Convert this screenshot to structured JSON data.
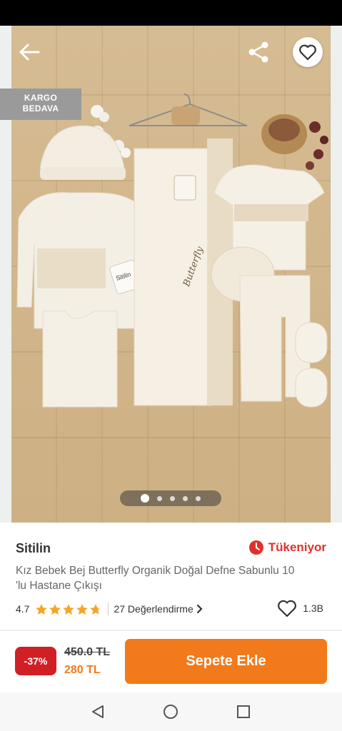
{
  "gallery": {
    "cargo_badge_line1": "KARGO",
    "cargo_badge_line2": "BEDAVA",
    "product_print": "Butterfly",
    "tag_text": "Sitilin",
    "page_count": 5,
    "active_page": 1
  },
  "product": {
    "brand": "Sitilin",
    "stock_status": "Tükeniyor",
    "title": "Kız Bebek Bej Butterfly Organik Doğal Defne Sabunlu 10 'lu Hastane Çıkışı",
    "rating": "4.7",
    "rating_value": 4.7,
    "review_count": "27 Değerlendirme",
    "favorite_count": "1.3B"
  },
  "cart": {
    "discount": "-37%",
    "old_price": "450.0 TL",
    "new_price": "280 TL",
    "add_button": "Sepete Ekle"
  },
  "colors": {
    "accent_orange": "#f27a1a",
    "discount_red": "#d11f26",
    "stock_red": "#e0302b",
    "star_gold": "#f5a623"
  },
  "icons": {
    "back": "arrow-left-icon",
    "share": "share-icon",
    "favorite": "heart-icon",
    "stock": "clock-icon",
    "chevron": "chevron-right-icon",
    "nav_back": "triangle-back-icon",
    "nav_home": "circle-home-icon",
    "nav_recent": "square-recent-icon"
  }
}
